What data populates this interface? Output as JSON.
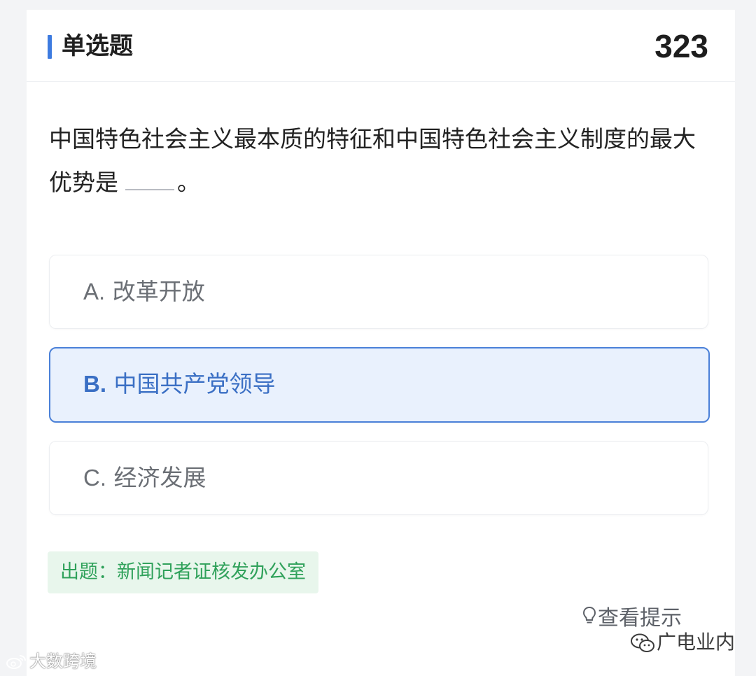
{
  "header": {
    "question_type": "单选题",
    "question_number": "323"
  },
  "question": {
    "text_before": "中国特色社会主义最本质的特征和中国特色社会主义制度的最大优势是",
    "text_after": "。"
  },
  "options": [
    {
      "letter": "A.",
      "text": "改革开放",
      "selected": false
    },
    {
      "letter": "B.",
      "text": "中国共产党领导",
      "selected": true
    },
    {
      "letter": "C.",
      "text": "经济发展",
      "selected": false
    }
  ],
  "source": {
    "label": "出题：新闻记者证核发办公室"
  },
  "hint": {
    "label": "查看提示",
    "icon": "lightbulb-icon"
  },
  "watermarks": {
    "left": "大数跨境",
    "right": "广电业内"
  },
  "colors": {
    "accent": "#3d7be0",
    "selected_bg": "#e9f1fd",
    "selected_text": "#3a6fc4",
    "source_bg": "#e8f6ec",
    "source_text": "#2fa15a"
  }
}
